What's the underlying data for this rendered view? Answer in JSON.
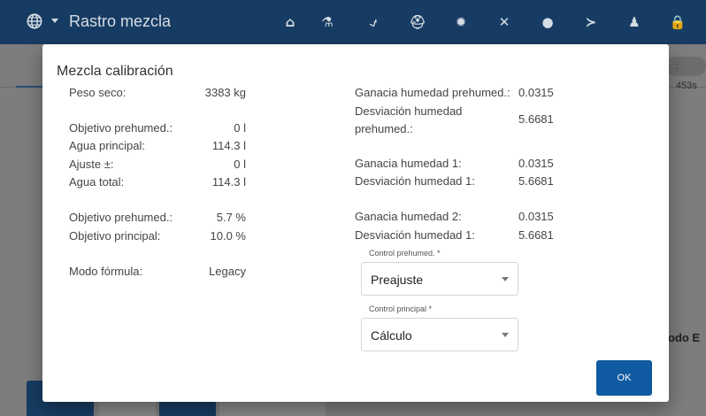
{
  "app": {
    "title": "Rastro mezcla",
    "nav_icons": [
      "home-icon",
      "flask-icon",
      "chart-icon",
      "ambulance-icon",
      "gear-icon",
      "tools-icon",
      "toggle-icon",
      "terminal-icon",
      "user-icon",
      "lock-icon"
    ],
    "nav_glyphs": [
      "⌂",
      "⚗",
      "⍻",
      "⛑",
      "✹",
      "✕",
      "●",
      "≻",
      "♟",
      "🔒"
    ]
  },
  "background": {
    "chip_text": ": 453s",
    "side_text": "odo E"
  },
  "dialog": {
    "title": "Mezcla calibración",
    "left": {
      "peso_seco": {
        "label": "Peso seco:",
        "value": "3383 kg"
      },
      "objetivo_prehumed_l": {
        "label": "Objetivo prehumed.:",
        "value": "0 l"
      },
      "agua_principal": {
        "label": "Agua principal:",
        "value": "114.3 l"
      },
      "ajuste": {
        "label": "Ajuste ±:",
        "value": "0 l"
      },
      "agua_total": {
        "label": "Agua total:",
        "value": "114.3 l"
      },
      "objetivo_prehumed_pct": {
        "label": "Objetivo prehumed.:",
        "value": "5.7 %"
      },
      "objetivo_principal": {
        "label": "Objetivo principal:",
        "value": "10.0 %"
      },
      "modo_formula": {
        "label": "Modo fórmula:",
        "value": "Legacy"
      }
    },
    "right": {
      "ganancia_prehumed": {
        "label": "Ganacia humedad prehumed.:",
        "value": "0.0315"
      },
      "desviacion_prehumed": {
        "label_line1": "Desviación humedad",
        "label_line2": "prehumed.:",
        "value": "5.6681"
      },
      "ganancia_1": {
        "label": "Ganacia humedad 1:",
        "value": "0.0315"
      },
      "desviacion_1": {
        "label": "Desviación humedad 1:",
        "value": "5.6681"
      },
      "ganancia_2": {
        "label": "Ganacia humedad 2:",
        "value": "0.0315"
      },
      "desviacion_1b": {
        "label": "Desviación humedad 1:",
        "value": "5.6681"
      }
    },
    "control_prehumed": {
      "label": "Control prehumed. *",
      "value": "Preajuste"
    },
    "control_principal": {
      "label": "Control principal *",
      "value": "Cálculo"
    },
    "ok_label": "OK"
  }
}
